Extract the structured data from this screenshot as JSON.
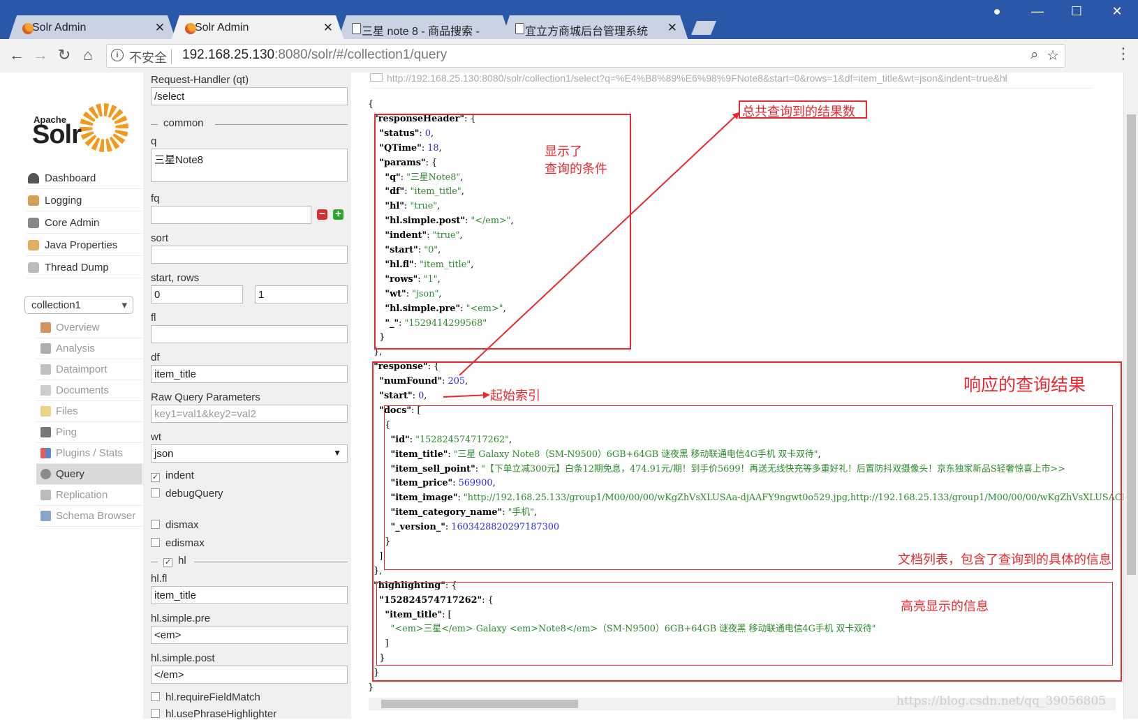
{
  "browser": {
    "tabs": [
      {
        "title": "Solr Admin",
        "favicon": "solr-icon",
        "active": false
      },
      {
        "title": "Solr Admin",
        "favicon": "solr-icon",
        "active": true
      },
      {
        "title": "三星 note 8 - 商品搜索 -",
        "favicon": "document-icon",
        "active": false
      },
      {
        "title": "宜立方商城后台管理系统",
        "favicon": "document-icon",
        "active": false
      }
    ],
    "security_label": "不安全",
    "url_host": "192.168.25.130",
    "url_rest": ":8080/solr/#/collection1/query"
  },
  "sidebar": {
    "logo_apache": "Apache",
    "logo_solr": "Solr",
    "items": [
      {
        "label": "Dashboard",
        "icon": "dashboard-icon"
      },
      {
        "label": "Logging",
        "icon": "logging-icon"
      },
      {
        "label": "Core Admin",
        "icon": "core-admin-icon"
      },
      {
        "label": "Java Properties",
        "icon": "java-properties-icon"
      },
      {
        "label": "Thread Dump",
        "icon": "thread-dump-icon"
      }
    ],
    "collection": "collection1",
    "core_items": [
      {
        "label": "Overview",
        "icon": "overview-icon",
        "active": false
      },
      {
        "label": "Analysis",
        "icon": "analysis-icon",
        "active": false
      },
      {
        "label": "Dataimport",
        "icon": "dataimport-icon",
        "active": false
      },
      {
        "label": "Documents",
        "icon": "documents-icon",
        "active": false
      },
      {
        "label": "Files",
        "icon": "files-icon",
        "active": false
      },
      {
        "label": "Ping",
        "icon": "ping-icon",
        "active": false
      },
      {
        "label": "Plugins / Stats",
        "icon": "plugins-icon",
        "active": false
      },
      {
        "label": "Query",
        "icon": "query-icon",
        "active": true
      },
      {
        "label": "Replication",
        "icon": "replication-icon",
        "active": false
      },
      {
        "label": "Schema Browser",
        "icon": "schema-browser-icon",
        "active": false
      }
    ]
  },
  "form": {
    "qt_label": "Request-Handler (qt)",
    "qt_value": "/select",
    "common_label": "common",
    "q_label": "q",
    "q_value": "三星Note8",
    "fq_label": "fq",
    "fq_value": "",
    "sort_label": "sort",
    "sort_value": "",
    "start_rows_label": "start, rows",
    "start_value": "0",
    "rows_value": "1",
    "fl_label": "fl",
    "fl_value": "",
    "df_label": "df",
    "df_value": "item_title",
    "raw_label": "Raw Query Parameters",
    "raw_placeholder": "key1=val1&key2=val2",
    "wt_label": "wt",
    "wt_value": "json",
    "indent_label": "indent",
    "indent_checked": true,
    "debug_label": "debugQuery",
    "debug_checked": false,
    "dismax_label": "dismax",
    "edismax_label": "edismax",
    "hl_label": "hl",
    "hl_checked": true,
    "hlfl_label": "hl.fl",
    "hlfl_value": "item_title",
    "hlpre_label": "hl.simple.pre",
    "hlpre_value": "<em>",
    "hlpost_label": "hl.simple.post",
    "hlpost_value": "</em>",
    "require_label": "hl.requireFieldMatch",
    "phrase_label": "hl.usePhraseHighlighter"
  },
  "result": {
    "request_url": "http://192.168.25.130:8080/solr/collection1/select?q=%E4%B8%89%E6%98%9FNote8&start=0&rows=1&df=item_title&wt=json&indent=true&hl",
    "json_lines": [
      [
        [
          "p",
          "{"
        ]
      ],
      [
        [
          "p",
          "  "
        ],
        [
          "k",
          "\"responseHeader\""
        ],
        [
          "p",
          ": {"
        ]
      ],
      [
        [
          "p",
          "    "
        ],
        [
          "k",
          "\"status\""
        ],
        [
          "p",
          ": "
        ],
        [
          "n",
          "0"
        ],
        [
          "p",
          ","
        ]
      ],
      [
        [
          "p",
          "    "
        ],
        [
          "k",
          "\"QTime\""
        ],
        [
          "p",
          ": "
        ],
        [
          "n",
          "18"
        ],
        [
          "p",
          ","
        ]
      ],
      [
        [
          "p",
          "    "
        ],
        [
          "k",
          "\"params\""
        ],
        [
          "p",
          ": {"
        ]
      ],
      [
        [
          "p",
          "      "
        ],
        [
          "k",
          "\"q\""
        ],
        [
          "p",
          ": "
        ],
        [
          "s",
          "\"三星Note8\""
        ],
        [
          "p",
          ","
        ]
      ],
      [
        [
          "p",
          "      "
        ],
        [
          "k",
          "\"df\""
        ],
        [
          "p",
          ": "
        ],
        [
          "s",
          "\"item_title\""
        ],
        [
          "p",
          ","
        ]
      ],
      [
        [
          "p",
          "      "
        ],
        [
          "k",
          "\"hl\""
        ],
        [
          "p",
          ": "
        ],
        [
          "s",
          "\"true\""
        ],
        [
          "p",
          ","
        ]
      ],
      [
        [
          "p",
          "      "
        ],
        [
          "k",
          "\"hl.simple.post\""
        ],
        [
          "p",
          ": "
        ],
        [
          "s",
          "\"</em>\""
        ],
        [
          "p",
          ","
        ]
      ],
      [
        [
          "p",
          "      "
        ],
        [
          "k",
          "\"indent\""
        ],
        [
          "p",
          ": "
        ],
        [
          "s",
          "\"true\""
        ],
        [
          "p",
          ","
        ]
      ],
      [
        [
          "p",
          "      "
        ],
        [
          "k",
          "\"start\""
        ],
        [
          "p",
          ": "
        ],
        [
          "s",
          "\"0\""
        ],
        [
          "p",
          ","
        ]
      ],
      [
        [
          "p",
          "      "
        ],
        [
          "k",
          "\"hl.fl\""
        ],
        [
          "p",
          ": "
        ],
        [
          "s",
          "\"item_title\""
        ],
        [
          "p",
          ","
        ]
      ],
      [
        [
          "p",
          "      "
        ],
        [
          "k",
          "\"rows\""
        ],
        [
          "p",
          ": "
        ],
        [
          "s",
          "\"1\""
        ],
        [
          "p",
          ","
        ]
      ],
      [
        [
          "p",
          "      "
        ],
        [
          "k",
          "\"wt\""
        ],
        [
          "p",
          ": "
        ],
        [
          "s",
          "\"json\""
        ],
        [
          "p",
          ","
        ]
      ],
      [
        [
          "p",
          "      "
        ],
        [
          "k",
          "\"hl.simple.pre\""
        ],
        [
          "p",
          ": "
        ],
        [
          "s",
          "\"<em>\""
        ],
        [
          "p",
          ","
        ]
      ],
      [
        [
          "p",
          "      "
        ],
        [
          "k",
          "\"_\""
        ],
        [
          "p",
          ": "
        ],
        [
          "s",
          "\"1529414299568\""
        ]
      ],
      [
        [
          "p",
          "    }"
        ]
      ],
      [
        [
          "p",
          "  },"
        ]
      ],
      [
        [
          "p",
          "  "
        ],
        [
          "k",
          "\"response\""
        ],
        [
          "p",
          ": {"
        ]
      ],
      [
        [
          "p",
          "    "
        ],
        [
          "k",
          "\"numFound\""
        ],
        [
          "p",
          ": "
        ],
        [
          "n",
          "205"
        ],
        [
          "p",
          ","
        ]
      ],
      [
        [
          "p",
          "    "
        ],
        [
          "k",
          "\"start\""
        ],
        [
          "p",
          ": "
        ],
        [
          "n",
          "0"
        ],
        [
          "p",
          ","
        ]
      ],
      [
        [
          "p",
          "    "
        ],
        [
          "k",
          "\"docs\""
        ],
        [
          "p",
          ": ["
        ]
      ],
      [
        [
          "p",
          "      {"
        ]
      ],
      [
        [
          "p",
          "        "
        ],
        [
          "k",
          "\"id\""
        ],
        [
          "p",
          ": "
        ],
        [
          "s",
          "\"152824574717262\""
        ],
        [
          "p",
          ","
        ]
      ],
      [
        [
          "p",
          "        "
        ],
        [
          "k",
          "\"item_title\""
        ],
        [
          "p",
          ": "
        ],
        [
          "s",
          "\"三星 Galaxy Note8（SM-N9500）6GB+64GB 谜夜黑 移动联通电信4G手机 双卡双待\""
        ],
        [
          "p",
          ","
        ]
      ],
      [
        [
          "p",
          "        "
        ],
        [
          "k",
          "\"item_sell_point\""
        ],
        [
          "p",
          ": "
        ],
        [
          "s",
          "\"【下单立减300元】白条12期免息，474.91元/期！到手价5699！再送无线快充等多重好礼！后置防抖双摄像头！京东独家新品S轻奢惊喜上市>>"
        ]
      ],
      [
        [
          "p",
          "        "
        ],
        [
          "k",
          "\"item_price\""
        ],
        [
          "p",
          ": "
        ],
        [
          "n",
          "569900"
        ],
        [
          "p",
          ","
        ]
      ],
      [
        [
          "p",
          "        "
        ],
        [
          "k",
          "\"item_image\""
        ],
        [
          "p",
          ": "
        ],
        [
          "s",
          "\"http://192.168.25.133/group1/M00/00/00/wKgZhVsXLUSAa-djAAFY9ngwt0o529.jpg,http://192.168.25.133/group1/M00/00/00/wKgZhVsXLUSACBhIA"
        ]
      ],
      [
        [
          "p",
          "        "
        ],
        [
          "k",
          "\"item_category_name\""
        ],
        [
          "p",
          ": "
        ],
        [
          "s",
          "\"手机\""
        ],
        [
          "p",
          ","
        ]
      ],
      [
        [
          "p",
          "        "
        ],
        [
          "k",
          "\"_version_\""
        ],
        [
          "p",
          ": "
        ],
        [
          "n",
          "1603428820297187300"
        ]
      ],
      [
        [
          "p",
          "      }"
        ]
      ],
      [
        [
          "p",
          "    ]"
        ]
      ],
      [
        [
          "p",
          "  },"
        ]
      ],
      [
        [
          "p",
          "  "
        ],
        [
          "k",
          "\"highlighting\""
        ],
        [
          "p",
          ": {"
        ]
      ],
      [
        [
          "p",
          "    "
        ],
        [
          "k",
          "\"152824574717262\""
        ],
        [
          "p",
          ": {"
        ]
      ],
      [
        [
          "p",
          "      "
        ],
        [
          "k",
          "\"item_title\""
        ],
        [
          "p",
          ": ["
        ]
      ],
      [
        [
          "p",
          "        "
        ],
        [
          "s",
          "\"<em>三星</em> Galaxy <em>Note8</em>（SM-N9500）6GB+64GB 谜夜黑 移动联通电信4G手机 双卡双待\""
        ]
      ],
      [
        [
          "p",
          "      ]"
        ]
      ],
      [
        [
          "p",
          "    }"
        ]
      ],
      [
        [
          "p",
          "  }"
        ]
      ],
      [
        [
          "p",
          "}"
        ]
      ]
    ]
  },
  "annotations": {
    "total_results": "总共查询到的结果数",
    "query_conditions_line1": "显示了",
    "query_conditions_line2": "查询的条件",
    "response_results": "响应的查询结果",
    "start_index": "起始索引",
    "docs_list": "文档列表，包含了查询到的具体的信息",
    "highlight_info": "高亮显示的信息",
    "color": "#e8282e"
  },
  "watermark": "https://blog.csdn.net/qq_39056805"
}
